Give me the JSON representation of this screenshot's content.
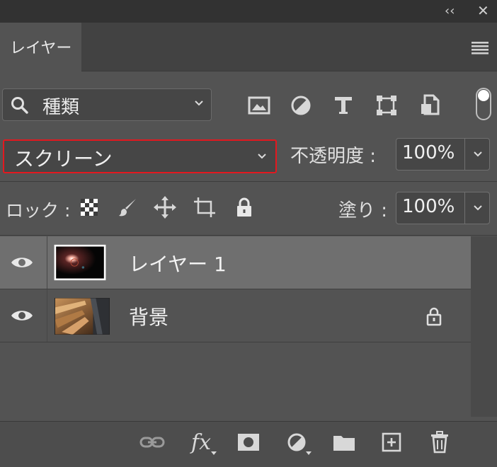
{
  "header": {
    "collapse_glyph": "‹‹",
    "close_glyph": "✕"
  },
  "tabs": {
    "active": "レイヤー"
  },
  "filter": {
    "label": "種類",
    "icons": [
      "image-filter-icon",
      "adjustment-filter-icon",
      "type-filter-icon",
      "shape-filter-icon",
      "smart-object-filter-icon"
    ]
  },
  "blend": {
    "mode": "スクリーン",
    "opacity_label": "不透明度 :",
    "opacity": "100%"
  },
  "lock": {
    "label": "ロック :",
    "icons": [
      "lock-transparent-pixels-icon",
      "lock-image-pixels-icon",
      "lock-position-icon",
      "lock-artboard-icon",
      "lock-all-icon"
    ],
    "fill_label": "塗り :",
    "fill": "100%"
  },
  "layers": [
    {
      "name": "レイヤー 1",
      "selected": true,
      "visible": true,
      "locked": false
    },
    {
      "name": "背景",
      "selected": false,
      "visible": true,
      "locked": true
    }
  ],
  "footer": {
    "fx": "fx",
    "icons": [
      "link-layers-icon",
      "fx-icon",
      "add-mask-icon",
      "new-adjustment-layer-icon",
      "new-group-icon",
      "new-layer-icon",
      "delete-icon"
    ]
  },
  "colors": {
    "panel": "#535353",
    "selected_row": "#6f6f6f",
    "highlight": "#e3181f"
  }
}
